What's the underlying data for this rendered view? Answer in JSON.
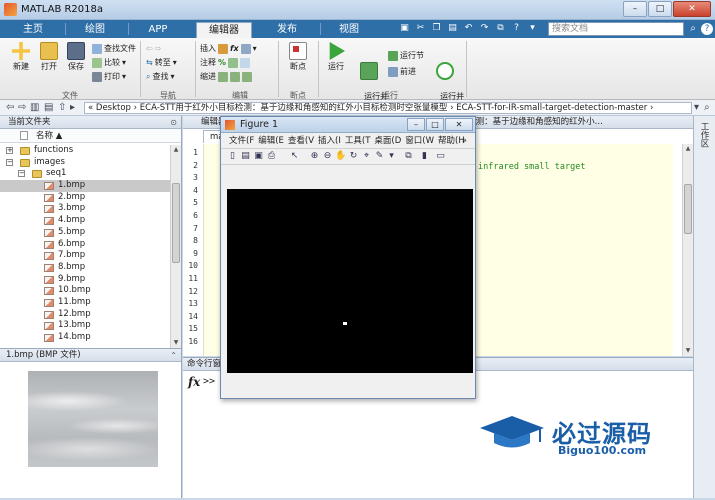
{
  "window": {
    "title": "MATLAB R2018a",
    "min": "–",
    "max": "□",
    "close": "✕"
  },
  "ribbon_tabs": [
    "主页",
    "绘图",
    "APP",
    "编辑器",
    "发布",
    "视图"
  ],
  "search": {
    "placeholder": "搜索文档"
  },
  "ribbon": {
    "file": {
      "group": "文件",
      "new": "新建",
      "open": "打开",
      "save": "保存",
      "find_file": "查找文件",
      "compare": "比较",
      "print": "打印"
    },
    "nav": {
      "group": "导航",
      "goto": "转至",
      "find": "查找"
    },
    "edit": {
      "group": "编辑",
      "insert": "插入",
      "comment": "注释",
      "indent": "缩进",
      "fx": "fx",
      "percent": "%"
    },
    "breakpoints": {
      "group": "断点",
      "label": "断点"
    },
    "run": {
      "group": "运行",
      "run": "运行",
      "run_advance": "运行并\n前进",
      "run_section": "运行节",
      "advance": "前进",
      "run_time": "运行并\n计时"
    }
  },
  "address": {
    "path": "«  Desktop  ›  ECA-STT用于红外小目标检测：基于边缘和角感知的红外小目标检测时空张量模型  ›  ECA-STT-for-IR-small-target-detection-master  ›"
  },
  "folder_panel": {
    "title": "当前文件夹",
    "col_name": "名称 ▲",
    "items": [
      {
        "label": "functions",
        "type": "folder",
        "level": 0,
        "expander": "+"
      },
      {
        "label": "images",
        "type": "folder",
        "level": 0,
        "expander": "−"
      },
      {
        "label": "seq1",
        "type": "folder",
        "level": 1,
        "expander": "−"
      },
      {
        "label": "1.bmp",
        "type": "bmp",
        "level": 2,
        "selected": true
      },
      {
        "label": "2.bmp",
        "type": "bmp",
        "level": 2
      },
      {
        "label": "3.bmp",
        "type": "bmp",
        "level": 2
      },
      {
        "label": "4.bmp",
        "type": "bmp",
        "level": 2
      },
      {
        "label": "5.bmp",
        "type": "bmp",
        "level": 2
      },
      {
        "label": "6.bmp",
        "type": "bmp",
        "level": 2
      },
      {
        "label": "7.bmp",
        "type": "bmp",
        "level": 2
      },
      {
        "label": "8.bmp",
        "type": "bmp",
        "level": 2
      },
      {
        "label": "9.bmp",
        "type": "bmp",
        "level": 2
      },
      {
        "label": "10.bmp",
        "type": "bmp",
        "level": 2
      },
      {
        "label": "11.bmp",
        "type": "bmp",
        "level": 2
      },
      {
        "label": "12.bmp",
        "type": "bmp",
        "level": 2
      },
      {
        "label": "13.bmp",
        "type": "bmp",
        "level": 2
      },
      {
        "label": "14.bmp",
        "type": "bmp",
        "level": 2
      }
    ]
  },
  "preview": {
    "title": "1.bmp  (BMP 文件)"
  },
  "editor": {
    "title": "编辑器 - C:\\Users\\Administrator\\Desktop\\ECA-STT用于红外小目标检测：基于边缘和角感知的红外小...",
    "tab": "mai",
    "line_numbers": [
      "1",
      "2",
      "3",
      "4",
      "5",
      "6",
      "7",
      "8",
      "9",
      "10",
      "11",
      "12",
      "13",
      "14",
      "15",
      "16"
    ],
    "comment_line": "infrared small target"
  },
  "workspace_strip": {
    "label": "工作区"
  },
  "command": {
    "title": "命令行窗口",
    "fx": "fx",
    "prompt": ">>"
  },
  "figure": {
    "title": "Figure 1",
    "menus": [
      "文件(F",
      "编辑(E",
      "查看(V",
      "插入(I",
      "工具(T",
      "桌面(D",
      "窗口(W",
      "帮助(H"
    ],
    "menu_more": "»"
  },
  "watermark": {
    "cn": "必过源码",
    "en": "Biguo100.com"
  }
}
